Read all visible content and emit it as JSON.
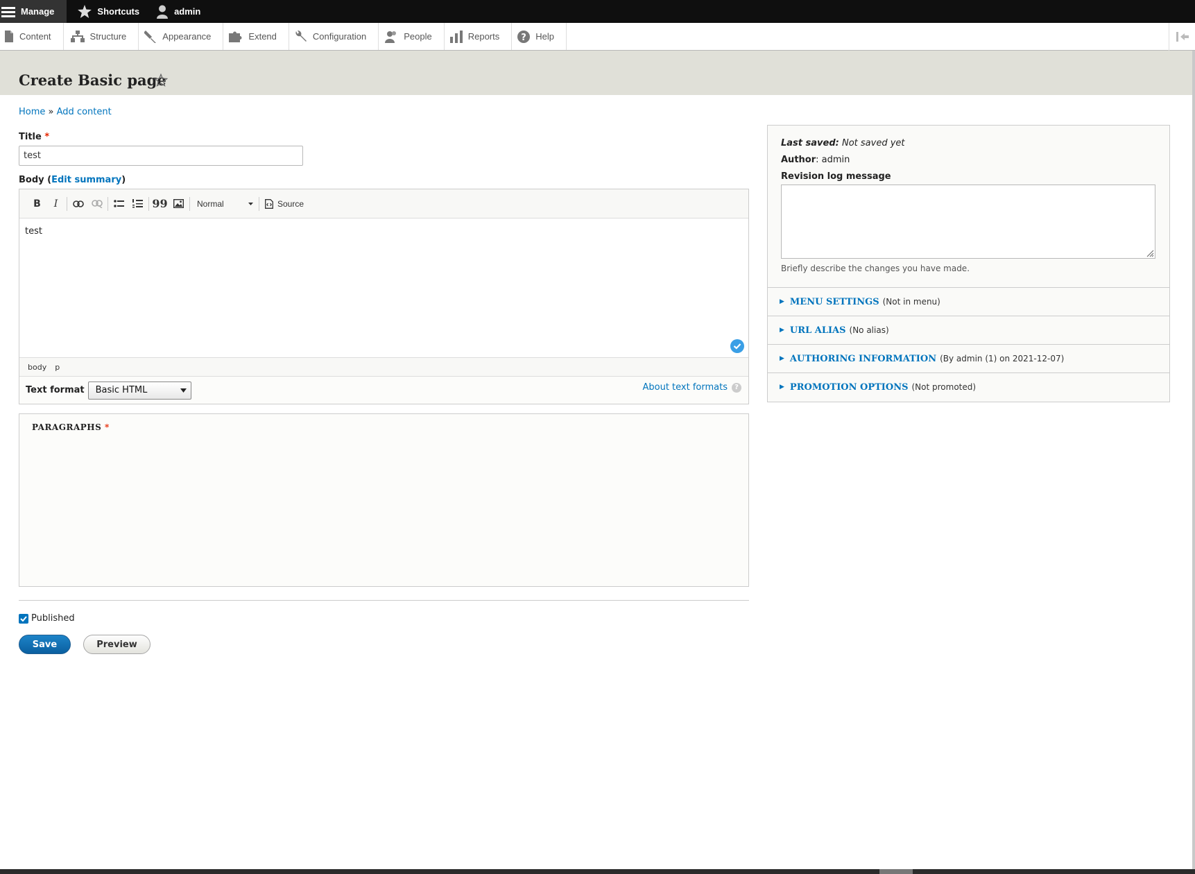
{
  "toolbar_top": {
    "manage": "Manage",
    "shortcuts": "Shortcuts",
    "user": "admin"
  },
  "tray": {
    "items": [
      "Content",
      "Structure",
      "Appearance",
      "Extend",
      "Configuration",
      "People",
      "Reports",
      "Help"
    ]
  },
  "page": {
    "title": "Create Basic page"
  },
  "breadcrumb": {
    "home": "Home",
    "sep": "»",
    "add_content": "Add content"
  },
  "form": {
    "title_label": "Title",
    "required_mark": "*",
    "title_value": "test",
    "body_label_prefix": "Body (",
    "edit_summary": "Edit summary",
    "body_label_suffix": ")",
    "editor": {
      "bold": "B",
      "italic": "I",
      "quote": "99",
      "heading_select": "Normal",
      "source": "Source",
      "content": "test",
      "path": [
        "body",
        "p"
      ]
    },
    "text_format_label": "Text format",
    "text_format_value": "Basic HTML",
    "about_formats": "About text formats",
    "help_mark": "?",
    "paragraphs_label": "PARAGRAPHS",
    "published_label": "Published",
    "save": "Save",
    "preview": "Preview"
  },
  "sidebar": {
    "last_saved_label": "Last saved:",
    "last_saved_value": "Not saved yet",
    "author_label": "Author",
    "author_value": ": admin",
    "revision_label": "Revision log message",
    "revision_desc": "Briefly describe the changes you have made.",
    "sections": [
      {
        "title": "MENU SETTINGS",
        "summary": "(Not in menu)"
      },
      {
        "title": "URL ALIAS",
        "summary": "(No alias)"
      },
      {
        "title": "AUTHORING INFORMATION",
        "summary": "(By admin (1) on 2021-12-07)"
      },
      {
        "title": "PROMOTION OPTIONS",
        "summary": "(Not promoted)"
      }
    ]
  },
  "colors": {
    "link": "#0074bd",
    "topbar": "#0f0f0f",
    "header_bg": "#e0e0d8",
    "required": "#e62600"
  }
}
